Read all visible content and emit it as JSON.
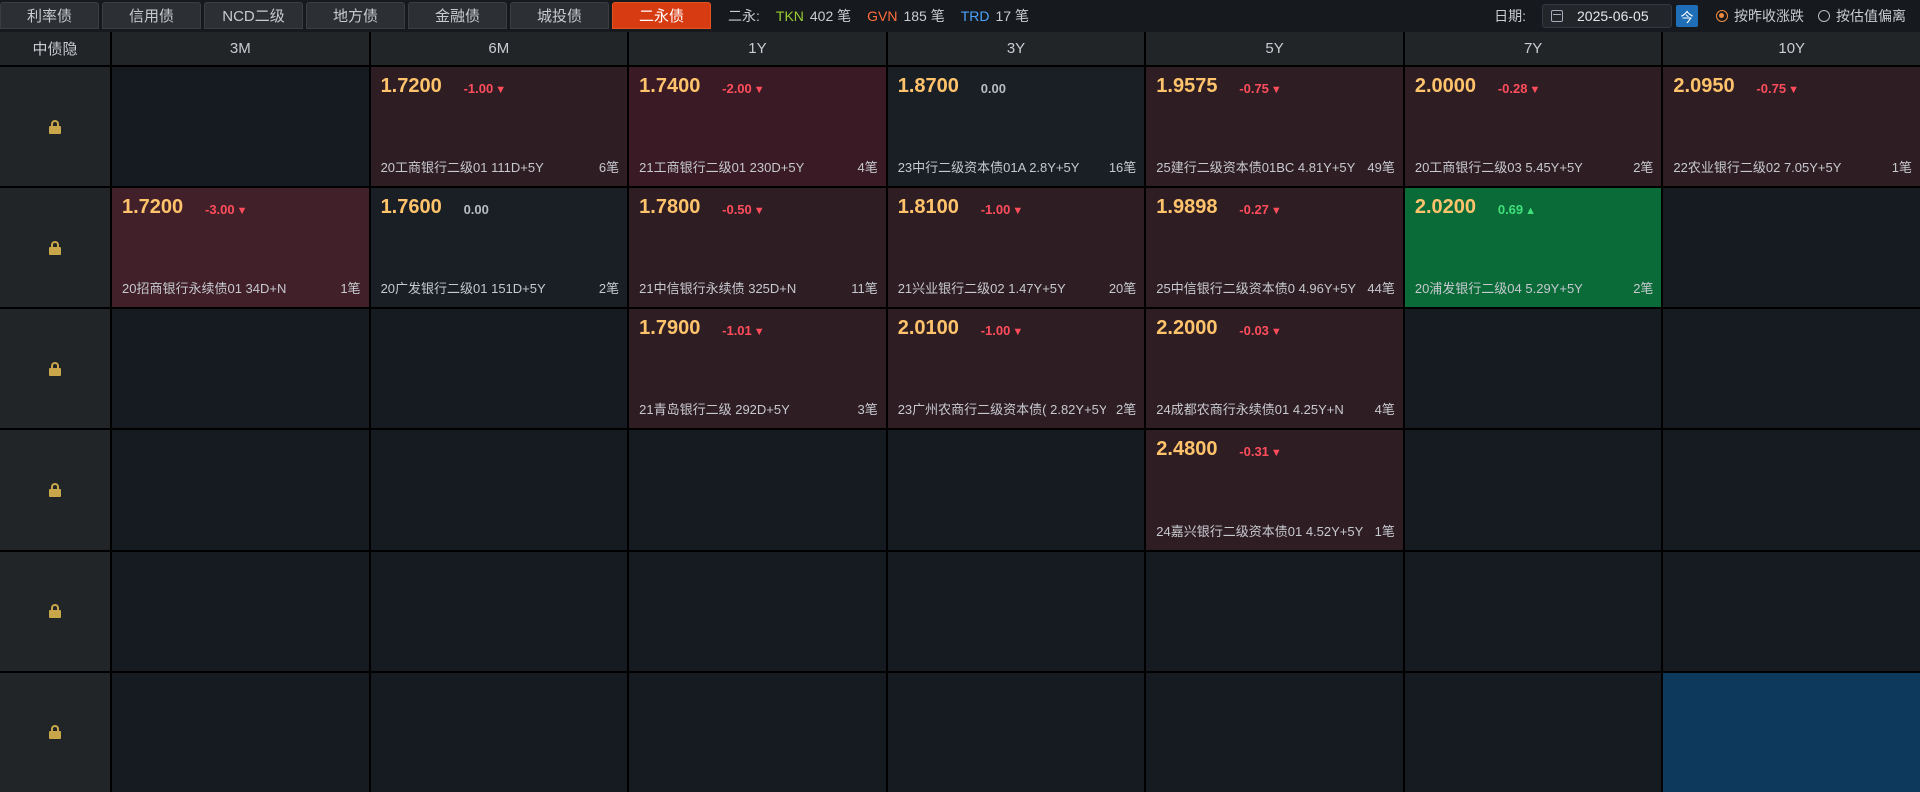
{
  "tabs": [
    {
      "label": "利率债",
      "active": false
    },
    {
      "label": "信用债",
      "active": false
    },
    {
      "label": "NCD二级",
      "active": false
    },
    {
      "label": "地方债",
      "active": false
    },
    {
      "label": "金融债",
      "active": false
    },
    {
      "label": "城投债",
      "active": false
    },
    {
      "label": "二永债",
      "active": true
    }
  ],
  "counters": {
    "label": "二永:",
    "tkn_label": "TKN",
    "tkn_value": "402 笔",
    "gvn_label": "GVN",
    "gvn_value": "185 笔",
    "trd_label": "TRD",
    "trd_value": "17 笔"
  },
  "controls": {
    "date_label": "日期:",
    "date_value": "2025-06-05",
    "today_label": "今",
    "radio1": "按昨收涨跌",
    "radio1_selected": true,
    "radio2": "按估值偏离",
    "radio2_selected": false
  },
  "grid": {
    "corner": "中债隐",
    "columns": [
      "3M",
      "6M",
      "1Y",
      "3Y",
      "5Y",
      "7Y",
      "10Y"
    ],
    "rows": [
      [
        null,
        {
          "price": "1.7200",
          "chg": "-1.00",
          "dir": "down",
          "name": "20工商银行二级01 111D+5Y",
          "count": "6笔",
          "tone": "red"
        },
        {
          "price": "1.7400",
          "chg": "-2.00",
          "dir": "down",
          "name": "21工商银行二级01 230D+5Y",
          "count": "4笔",
          "tone": "red-dark"
        },
        {
          "price": "1.8700",
          "chg": "0.00",
          "dir": "zero",
          "name": "23中行二级资本债01A 2.8Y+5Y",
          "count": "16笔",
          "tone": "neutral"
        },
        {
          "price": "1.9575",
          "chg": "-0.75",
          "dir": "down",
          "name": "25建行二级资本债01BC 4.81Y+5Y",
          "count": "49笔",
          "tone": "red"
        },
        {
          "price": "2.0000",
          "chg": "-0.28",
          "dir": "down",
          "name": "20工商银行二级03 5.45Y+5Y",
          "count": "2笔",
          "tone": "red"
        },
        {
          "price": "2.0950",
          "chg": "-0.75",
          "dir": "down",
          "name": "22农业银行二级02 7.05Y+5Y",
          "count": "1笔",
          "tone": "red"
        }
      ],
      [
        {
          "price": "1.7200",
          "chg": "-3.00",
          "dir": "down",
          "name": "20招商银行永续债01 34D+N",
          "count": "1笔",
          "tone": "red-strong"
        },
        {
          "price": "1.7600",
          "chg": "0.00",
          "dir": "zero",
          "name": "20广发银行二级01 151D+5Y",
          "count": "2笔",
          "tone": "neutral"
        },
        {
          "price": "1.7800",
          "chg": "-0.50",
          "dir": "down",
          "name": "21中信银行永续债 325D+N",
          "count": "11笔",
          "tone": "red"
        },
        {
          "price": "1.8100",
          "chg": "-1.00",
          "dir": "down",
          "name": "21兴业银行二级02 1.47Y+5Y",
          "count": "20笔",
          "tone": "red"
        },
        {
          "price": "1.9898",
          "chg": "-0.27",
          "dir": "down",
          "name": "25中信银行二级资本债0 4.96Y+5Y",
          "count": "44笔",
          "tone": "red"
        },
        {
          "price": "2.0200",
          "chg": "0.69",
          "dir": "up",
          "name": "20浦发银行二级04 5.29Y+5Y",
          "count": "2笔",
          "tone": "green"
        },
        null
      ],
      [
        null,
        null,
        {
          "price": "1.7900",
          "chg": "-1.01",
          "dir": "down",
          "name": "21青岛银行二级 292D+5Y",
          "count": "3笔",
          "tone": "red"
        },
        {
          "price": "2.0100",
          "chg": "-1.00",
          "dir": "down",
          "name": "23广州农商行二级资本债( 2.82Y+5Y",
          "count": "2笔",
          "tone": "red"
        },
        {
          "price": "2.2000",
          "chg": "-0.03",
          "dir": "down",
          "name": "24成都农商行永续债01 4.25Y+N",
          "count": "4笔",
          "tone": "red"
        },
        null,
        null
      ],
      [
        null,
        null,
        null,
        null,
        {
          "price": "2.4800",
          "chg": "-0.31",
          "dir": "down",
          "name": "24嘉兴银行二级资本债01 4.52Y+5Y",
          "count": "1笔",
          "tone": "red"
        },
        null,
        null
      ],
      [
        null,
        null,
        null,
        null,
        null,
        null,
        null
      ],
      [
        null,
        null,
        null,
        null,
        null,
        null,
        {
          "tone": "blue"
        }
      ]
    ]
  },
  "colors": {
    "accent_tab": "#d63b12",
    "price": "#ffc46b",
    "down": "#ff4d5c",
    "up": "#3fe07a",
    "lock": "#c9a64a"
  }
}
